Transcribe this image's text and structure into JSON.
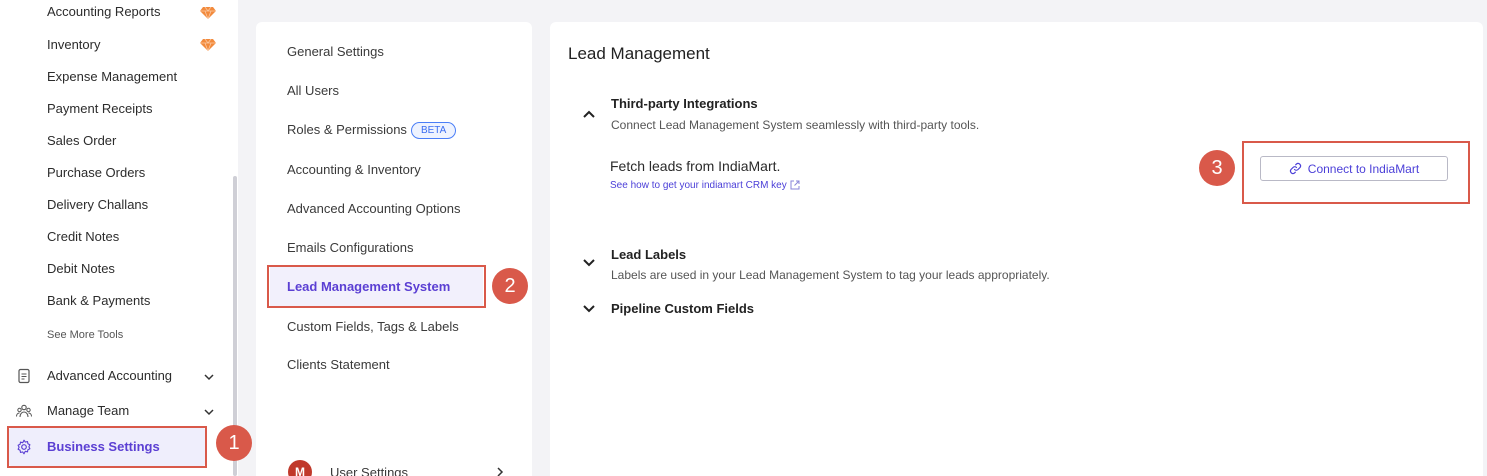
{
  "sidebar": {
    "items": [
      {
        "label": "Accounting Reports",
        "premium": true
      },
      {
        "label": "Inventory",
        "premium": true
      },
      {
        "label": "Expense Management"
      },
      {
        "label": "Payment Receipts"
      },
      {
        "label": "Sales Order"
      },
      {
        "label": "Purchase Orders"
      },
      {
        "label": "Delivery Challans"
      },
      {
        "label": "Credit Notes"
      },
      {
        "label": "Debit Notes"
      },
      {
        "label": "Bank & Payments"
      }
    ],
    "see_more": "See More Tools",
    "groups": [
      {
        "label": "Advanced Accounting",
        "icon": "document-icon"
      },
      {
        "label": "Manage Team",
        "icon": "team-icon"
      }
    ],
    "active": {
      "label": "Business Settings",
      "icon": "gear-icon"
    }
  },
  "settings_menu": {
    "items": [
      {
        "label": "General Settings"
      },
      {
        "label": "All Users"
      },
      {
        "label": "Roles & Permissions",
        "badge": "BETA"
      },
      {
        "label": "Accounting & Inventory"
      },
      {
        "label": "Advanced Accounting Options"
      },
      {
        "label": "Emails Configurations"
      },
      {
        "label": "Lead Management System",
        "active": true
      },
      {
        "label": "Custom Fields, Tags & Labels"
      },
      {
        "label": "Clients Statement"
      }
    ],
    "user": {
      "avatar_letter": "M",
      "label": "User Settings"
    }
  },
  "main": {
    "title": "Lead Management",
    "sections": [
      {
        "title": "Third-party Integrations",
        "description": "Connect Lead Management System seamlessly with third-party tools.",
        "expanded": true,
        "fetch_label": "Fetch leads from IndiaMart.",
        "help_link": "See how to get your indiamart CRM key",
        "button_label": "Connect to IndiaMart"
      },
      {
        "title": "Lead Labels",
        "description": "Labels are used in your Lead Management System to tag your leads appropriately.",
        "expanded": false
      },
      {
        "title": "Pipeline Custom Fields",
        "expanded": false
      }
    ]
  },
  "annotations": {
    "step1": "1",
    "step2": "2",
    "step3": "3",
    "color": "#d9594a"
  },
  "colors": {
    "accent": "#5b3fd3",
    "link": "#4b3fd8",
    "beta": "#3b6df0"
  }
}
